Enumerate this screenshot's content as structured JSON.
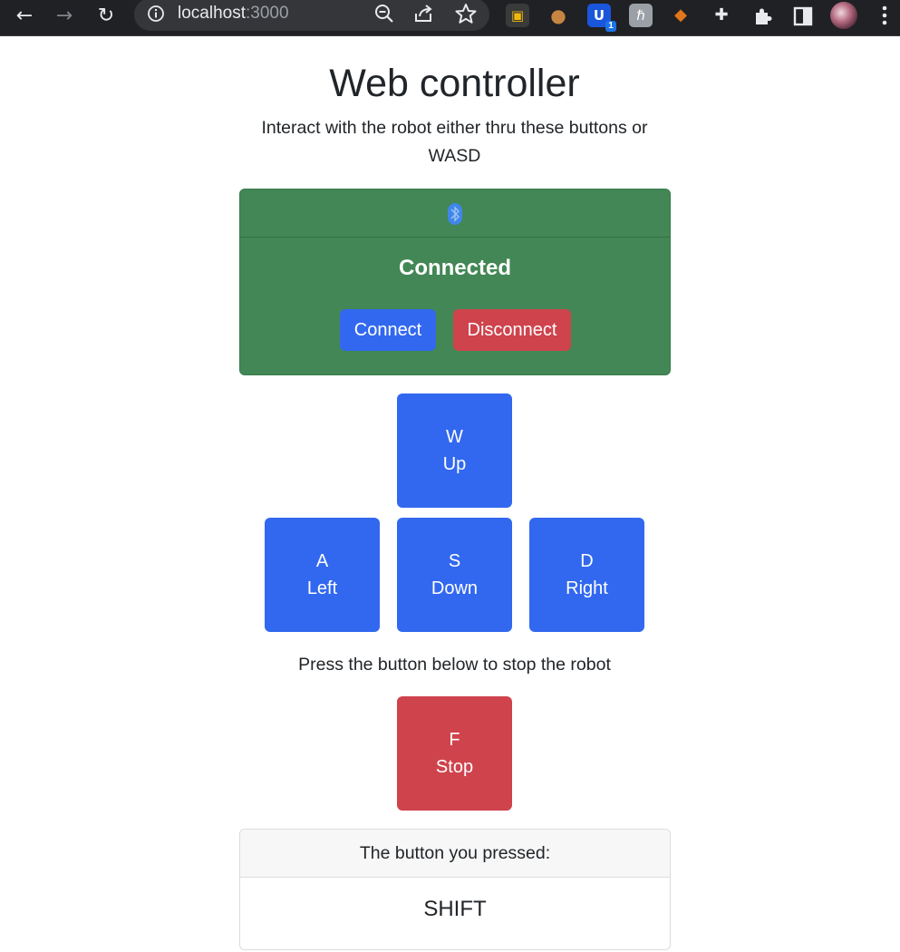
{
  "browser": {
    "url_host": "localhost",
    "url_port": ":3000",
    "icons": {
      "back": "arrow-left-icon",
      "forward": "arrow-right-icon",
      "reload": "reload-icon",
      "info": "info-icon",
      "zoom": "zoom-out-icon",
      "share": "share-icon",
      "bookmark": "star-icon",
      "extensions_menu": "puzzle-icon",
      "side_panel": "side-panel-icon",
      "menu": "kebab-menu-icon"
    },
    "extensions": [
      {
        "name": "cube-extension-icon",
        "glyph": "▣",
        "bg": "#3a3a3a",
        "fg": "#f0b90b"
      },
      {
        "name": "cookie-extension-icon",
        "glyph": "●",
        "bg": "#202124",
        "fg": "#c68642"
      },
      {
        "name": "shield-extension-icon",
        "glyph": "U",
        "bg": "#1a56db",
        "fg": "#ffffff",
        "badge": "1"
      },
      {
        "name": "letter-extension-icon",
        "glyph": "ℏ",
        "bg": "#9aa0a6",
        "fg": "#ffffff"
      },
      {
        "name": "fox-extension-icon",
        "glyph": "◆",
        "bg": "#202124",
        "fg": "#e2761b"
      },
      {
        "name": "pin-extension-icon",
        "glyph": "✚",
        "bg": "#202124",
        "fg": "#e8eaed"
      }
    ]
  },
  "page": {
    "title": "Web controller",
    "subtitle": "Interact with the robot either thru these buttons or WASD",
    "connection": {
      "status": "Connected",
      "connect_label": "Connect",
      "disconnect_label": "Disconnect",
      "icon": "bluetooth-icon"
    },
    "keys": {
      "up": {
        "key": "W",
        "label": "Up"
      },
      "left": {
        "key": "A",
        "label": "Left"
      },
      "down": {
        "key": "S",
        "label": "Down"
      },
      "right": {
        "key": "D",
        "label": "Right"
      },
      "stop": {
        "key": "F",
        "label": "Stop"
      }
    },
    "stop_hint": "Press the button below to stop the robot",
    "pressed": {
      "header": "The button you pressed:",
      "value": "SHIFT"
    }
  },
  "colors": {
    "primary": "#3268ef",
    "danger": "#cf434c",
    "success_card": "#428755",
    "bluetooth": "#3f86e8"
  }
}
